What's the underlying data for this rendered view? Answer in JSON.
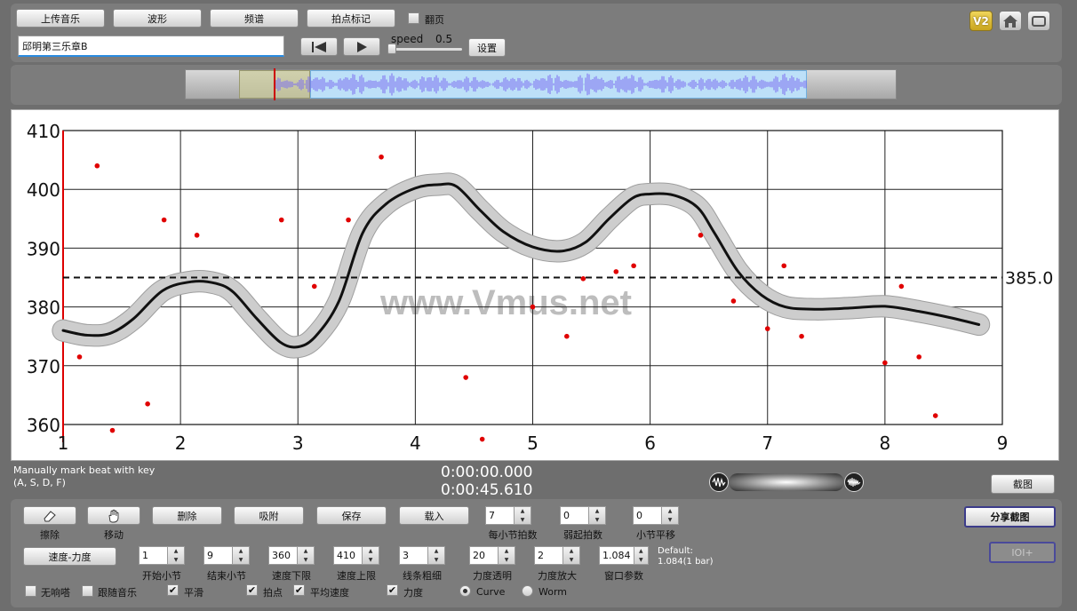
{
  "toolbar": {
    "upload_label": "上传音乐",
    "waveform_label": "波形",
    "spectrum_label": "频谱",
    "beat_mark_label": "拍点标记",
    "page_turn_label": "翻页",
    "song_title": "邱明第三乐章B",
    "speed_label": "speed",
    "speed_value": "0.5",
    "set_label": "设置",
    "version_badge": "V2"
  },
  "chart_data": {
    "type": "scatter",
    "xlim": [
      1,
      9
    ],
    "ylim": [
      360,
      410
    ],
    "x_ticks": [
      "1",
      "2",
      "3",
      "4",
      "5",
      "6",
      "7",
      "8",
      "9"
    ],
    "y_ticks": [
      "360",
      "370",
      "380",
      "390",
      "400",
      "410"
    ],
    "threshold": 385,
    "threshold_label": "385.0",
    "grid": true,
    "watermark": "www.Vmus.net",
    "beats": [
      [
        1.14,
        371.5
      ],
      [
        1.29,
        404.0
      ],
      [
        1.42,
        359.0
      ],
      [
        1.72,
        363.5
      ],
      [
        1.86,
        394.8
      ],
      [
        2.14,
        392.2
      ],
      [
        2.86,
        394.8
      ],
      [
        3.14,
        383.5
      ],
      [
        3.43,
        394.8
      ],
      [
        3.71,
        405.5
      ],
      [
        4.43,
        368.0
      ],
      [
        4.57,
        357.5
      ],
      [
        5.0,
        380.0
      ],
      [
        5.29,
        375.0
      ],
      [
        5.43,
        384.8
      ],
      [
        5.71,
        386.0
      ],
      [
        5.86,
        387.0
      ],
      [
        6.43,
        392.2
      ],
      [
        6.71,
        381.0
      ],
      [
        7.0,
        376.3
      ],
      [
        7.14,
        387.0
      ],
      [
        7.29,
        375.0
      ],
      [
        8.0,
        370.5
      ],
      [
        8.14,
        383.5
      ],
      [
        8.29,
        371.5
      ],
      [
        8.43,
        361.5
      ]
    ],
    "curve": [
      [
        1.0,
        376.0
      ],
      [
        1.2,
        375.2
      ],
      [
        1.4,
        375.5
      ],
      [
        1.6,
        378.0
      ],
      [
        1.85,
        382.8
      ],
      [
        2.1,
        384.3
      ],
      [
        2.3,
        384.0
      ],
      [
        2.45,
        382.5
      ],
      [
        2.65,
        378.0
      ],
      [
        2.85,
        374.0
      ],
      [
        3.0,
        373.2
      ],
      [
        3.15,
        375.0
      ],
      [
        3.35,
        381.0
      ],
      [
        3.55,
        392.5
      ],
      [
        3.75,
        397.5
      ],
      [
        4.0,
        400.2
      ],
      [
        4.2,
        400.8
      ],
      [
        4.35,
        400.5
      ],
      [
        4.55,
        396.5
      ],
      [
        4.75,
        392.8
      ],
      [
        5.0,
        390.2
      ],
      [
        5.25,
        389.5
      ],
      [
        5.45,
        391.0
      ],
      [
        5.65,
        395.0
      ],
      [
        5.85,
        398.5
      ],
      [
        6.0,
        399.2
      ],
      [
        6.2,
        399.0
      ],
      [
        6.4,
        397.0
      ],
      [
        6.55,
        392.5
      ],
      [
        6.75,
        386.0
      ],
      [
        6.95,
        382.0
      ],
      [
        7.15,
        380.0
      ],
      [
        7.4,
        379.6
      ],
      [
        7.7,
        379.8
      ],
      [
        8.0,
        380.1
      ],
      [
        8.3,
        379.2
      ],
      [
        8.55,
        378.2
      ],
      [
        8.8,
        377.0
      ]
    ],
    "band_halfwidth": 1.3
  },
  "status": {
    "hint_line1": "Manually mark beat with key",
    "hint_line2": "(A, S, D, F)",
    "time_current": "0:00:00.000",
    "time_total": "0:00:45.610",
    "screenshot_label": "截图"
  },
  "controls": {
    "erase_label": "擦除",
    "move_label": "移动",
    "delete_label": "删除",
    "snap_label": "吸附",
    "save_label": "保存",
    "load_label": "载入",
    "beats_per_bar_value": "7",
    "beats_per_bar_label": "每小节拍数",
    "weak_beats_value": "0",
    "weak_beats_label": "弱起拍数",
    "bar_shift_value": "0",
    "bar_shift_label": "小节平移",
    "share_label": "分享截图",
    "ioi_label": "IOI+",
    "tempo_dynamics_label": "速度-力度",
    "start_bar_value": "1",
    "start_bar_label": "开始小节",
    "end_bar_value": "9",
    "end_bar_label": "结束小节",
    "tempo_min_value": "360",
    "tempo_min_label": "速度下限",
    "tempo_max_value": "410",
    "tempo_max_label": "速度上限",
    "line_width_value": "3",
    "line_width_label": "线条粗细",
    "dyn_opacity_value": "20",
    "dyn_opacity_label": "力度透明",
    "dyn_scale_value": "2",
    "dyn_scale_label": "力度放大",
    "window_value": "1.084",
    "window_label": "窗口参数",
    "default_line1": "Default:",
    "default_line2": "1.084(1 bar)",
    "no_click_label": "无响嗒",
    "follow_music_label": "跟随音乐",
    "smooth_label": "平滑",
    "beat_points_label": "拍点",
    "avg_tempo_label": "平均速度",
    "dynamics_label": "力度",
    "curve_label": "Curve",
    "worm_label": "Worm"
  }
}
